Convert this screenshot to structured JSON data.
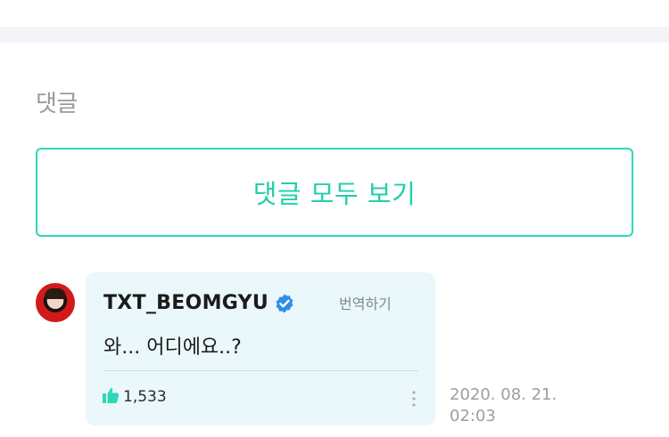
{
  "comments_section": {
    "title": "댓글",
    "view_all_label": "댓글 모두 보기"
  },
  "comment": {
    "author": "TXT_BEOMGYU",
    "verified_icon": "verified-badge-icon",
    "translate_label": "번역하기",
    "text": "와... 어디에요..?",
    "likes": "1,533",
    "date": "2020. 08. 21.",
    "time": "02:03",
    "accent_color": "#2ed8b6"
  }
}
